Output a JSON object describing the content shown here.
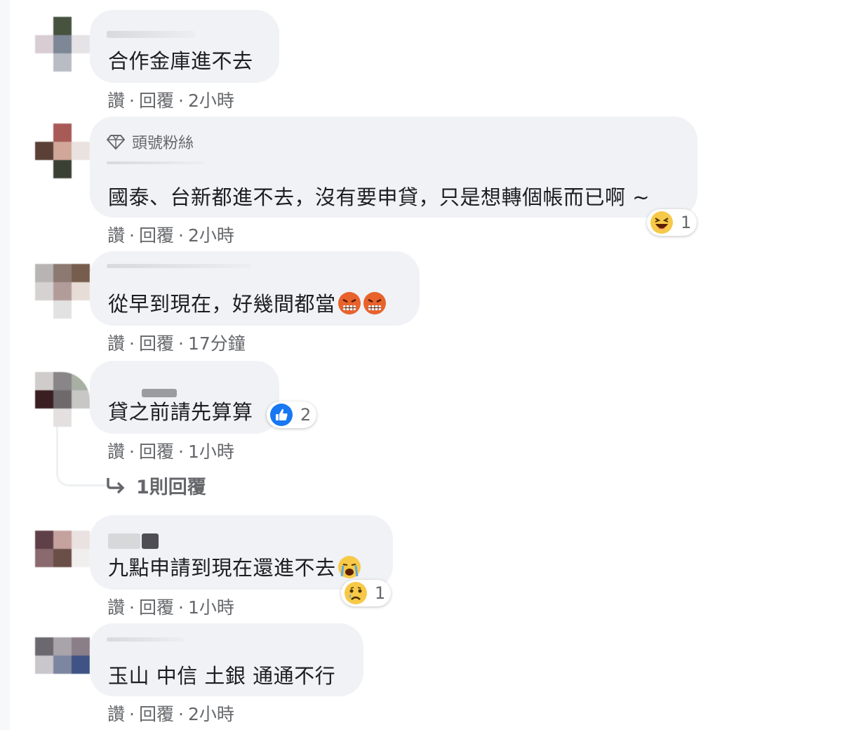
{
  "actions": {
    "like": "讚",
    "reply": "回覆",
    "dot": "·"
  },
  "badge": {
    "label": "頭號粉絲",
    "icon": "diamond-icon"
  },
  "comments": [
    {
      "text": "合作金庫進不去",
      "time": "2小時"
    },
    {
      "text": "國泰、台新都進不去，沒有要申貸，只是想轉個帳而已啊 ~",
      "time": "2小時",
      "reaction": {
        "icon": "haha-emoji-icon",
        "count": "1"
      }
    },
    {
      "text": "從早到現在，好幾間都當",
      "time": "17分鐘",
      "inline_emoji": "angry-face-icon"
    },
    {
      "text": "貸之前請先算算",
      "time": "1小時",
      "reaction": {
        "icon": "like-reaction-icon",
        "count": "2"
      }
    },
    {
      "text": "九點申請到現在還進不去",
      "time": "1小時",
      "inline_emoji": "crying-face-icon",
      "reaction": {
        "icon": "sad-emoji-icon",
        "count": "1"
      }
    },
    {
      "text": "玉山 中信 土銀 通通不行",
      "time": "2小時"
    }
  ],
  "replies_link": {
    "label": "1則回覆",
    "icon": "reply-arrow-icon"
  },
  "colors": {
    "bubble": "#f0f2f5",
    "meta_text": "#65676b",
    "body_text": "#1c1e21",
    "like_blue": "#1877f2"
  }
}
